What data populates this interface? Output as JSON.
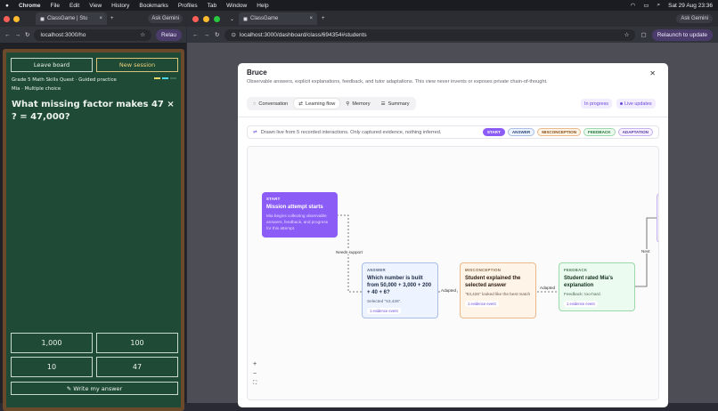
{
  "menubar": {
    "app": "Chrome",
    "items": [
      "File",
      "Edit",
      "View",
      "History",
      "Bookmarks",
      "Profiles",
      "Tab",
      "Window",
      "Help"
    ],
    "clock": "Sat 29 Aug  23:36"
  },
  "left_window": {
    "tab_title": "ClassGame | Stu",
    "ask_gemini": "Ask Gemini",
    "url": "localhost:3000/ho",
    "relaunch": "Relau",
    "leave_board": "Leave board",
    "new_session": "New session",
    "course": "Grade 5 Math Skills Quest · Guided practice",
    "student_mode": "Mia · Multiple choice",
    "question": "What missing factor makes 47 × ? = 47,000?",
    "answers": [
      "1,000",
      "100",
      "10",
      "47"
    ],
    "write_answer": "✎ Write my answer"
  },
  "right_window": {
    "tab_title": "ClassGame",
    "ask_gemini": "Ask Gemini",
    "url": "localhost:3000/dashboard/class/694354#students",
    "relaunch": "Relaunch to update"
  },
  "modal": {
    "title": "Bruce",
    "subtitle": "Observable answers, explicit explanations, feedback, and tutor adaptations. This view never invents or exposes private chain-of-thought.",
    "tabs": [
      "Conversation",
      "Learning flow",
      "Memory",
      "Summary"
    ],
    "active_tab": "Learning flow",
    "status": "In progress",
    "live": "Live updates",
    "info": "Drawn live from 5 recorded interactions. Only captured evidence, nothing inferred.",
    "legend": [
      "START",
      "ANSWER",
      "MISCONCEPTION",
      "FEEDBACK",
      "ADAPTATION"
    ],
    "nodes": {
      "start": {
        "kind": "START",
        "title": "Mission attempt starts",
        "desc": "Mia begins collecting observable answers, feedback, and progress for this attempt."
      },
      "answer": {
        "kind": "ANSWER",
        "title": "Which number is built from 50,000 + 3,000 + 200 + 40 + 6?",
        "desc": "Selected \"53,426\".",
        "evidence": "1 evidence event"
      },
      "misconception": {
        "kind": "MISCONCEPTION",
        "title": "Student explained the selected answer",
        "desc": "\"53,426\" looked like the best match",
        "evidence": "1 evidence event"
      },
      "feedback": {
        "kind": "FEEDBACK",
        "title": "Student rated Mia's explanation",
        "desc": "Feedback: too-hard.",
        "evidence": "1 evidence event"
      }
    },
    "edges": {
      "needs_support": "Needs support",
      "adapted1": "Adapted",
      "adapted2": "Adapted",
      "next": "Next"
    },
    "zoom": {
      "in": "+",
      "out": "−",
      "fit": "⛶"
    }
  },
  "colors": {
    "chalkboard": "#1e4a36",
    "start": "#8b5cf6",
    "answer": "#eef4ff",
    "misconception": "#fff4e8",
    "feedback": "#ecfbef",
    "accent": "#6a48d8"
  }
}
